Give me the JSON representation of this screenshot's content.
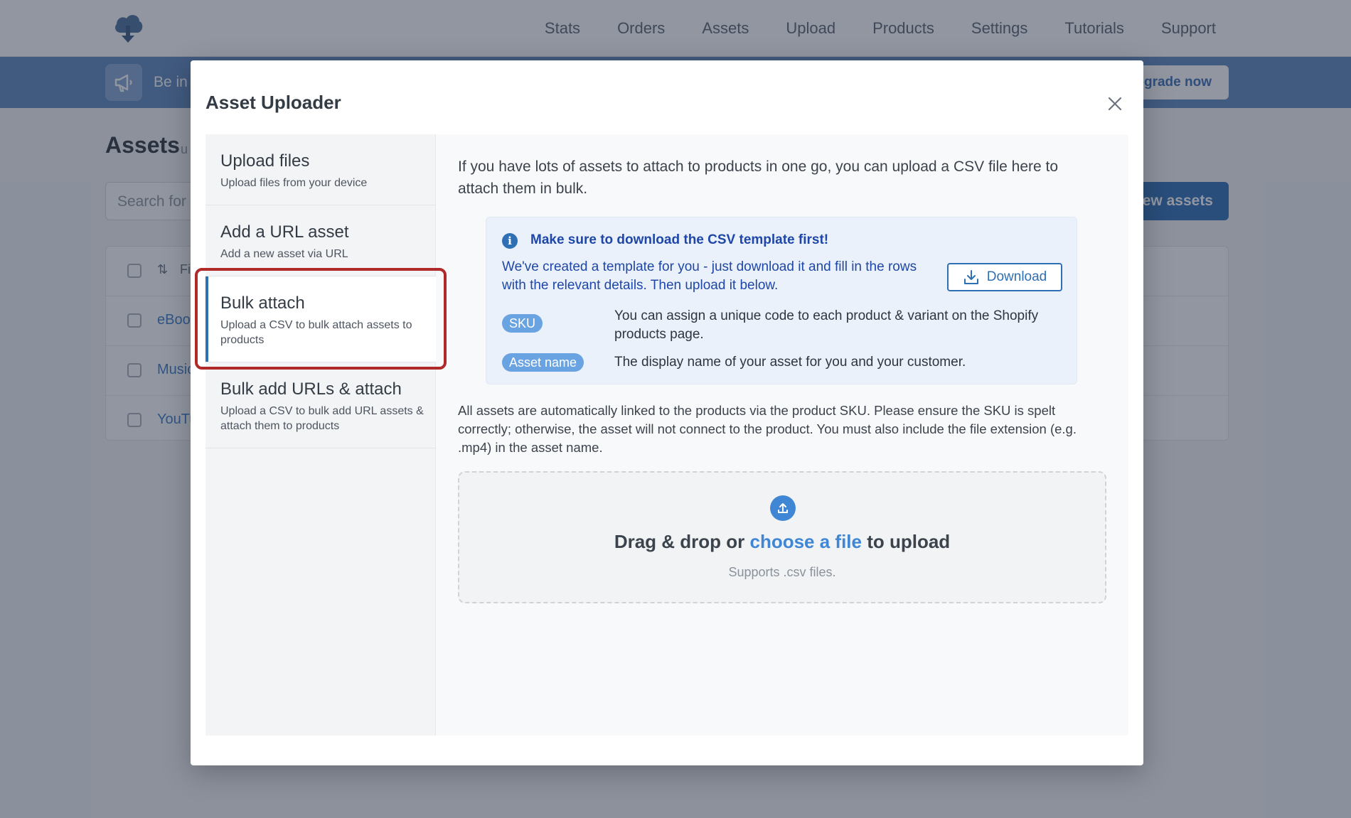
{
  "nav": {
    "items": [
      "Stats",
      "Orders",
      "Assets",
      "Upload",
      "Products",
      "Settings",
      "Tutorials",
      "Support"
    ]
  },
  "banner": {
    "text": "Be in",
    "button": "pgrade now"
  },
  "page": {
    "title": "Assets",
    "title_suffix": "u",
    "search_placeholder": "Search for",
    "new_assets_button": "ew assets",
    "table_header": "Fi",
    "rows": [
      "eBoo",
      "Music",
      "YouTu"
    ]
  },
  "modal": {
    "title": "Asset Uploader",
    "sidebar": [
      {
        "title": "Upload files",
        "subtitle": "Upload files from your device"
      },
      {
        "title": "Add a URL asset",
        "subtitle": "Add a new asset via URL"
      },
      {
        "title": "Bulk attach",
        "subtitle": "Upload a CSV to bulk attach assets to products"
      },
      {
        "title": "Bulk add URLs & attach",
        "subtitle": "Upload a CSV to bulk add URL assets & attach them to products"
      }
    ],
    "intro": "If you have lots of assets to attach to products in one go, you can upload a CSV file here to attach them in bulk.",
    "info": {
      "heading": "Make sure to download the CSV template first!",
      "text": "We've created a template for you - just download it and fill in the rows with the relevant details. Then upload it below.",
      "download_button": "Download",
      "fields": [
        {
          "label": "SKU",
          "description": "You can assign a unique code to each product & variant on the Shopify products page."
        },
        {
          "label": "Asset name",
          "description": "The display name of your asset for you and your customer."
        }
      ]
    },
    "note": "All assets are automatically linked to the products via the product SKU. Please ensure the SKU is spelt correctly; otherwise, the asset will not connect to the product. You must also include the file extension (e.g. .mp4) in the asset name.",
    "dropzone": {
      "text_before": "Drag & drop or ",
      "link": "choose a file",
      "text_after": " to upload",
      "sub": "Supports .csv files."
    }
  },
  "colors": {
    "accent": "#2f6fb4",
    "highlight_border": "#b02a2a",
    "info_text": "#1f47a8",
    "pill": "#6aa3e2"
  }
}
